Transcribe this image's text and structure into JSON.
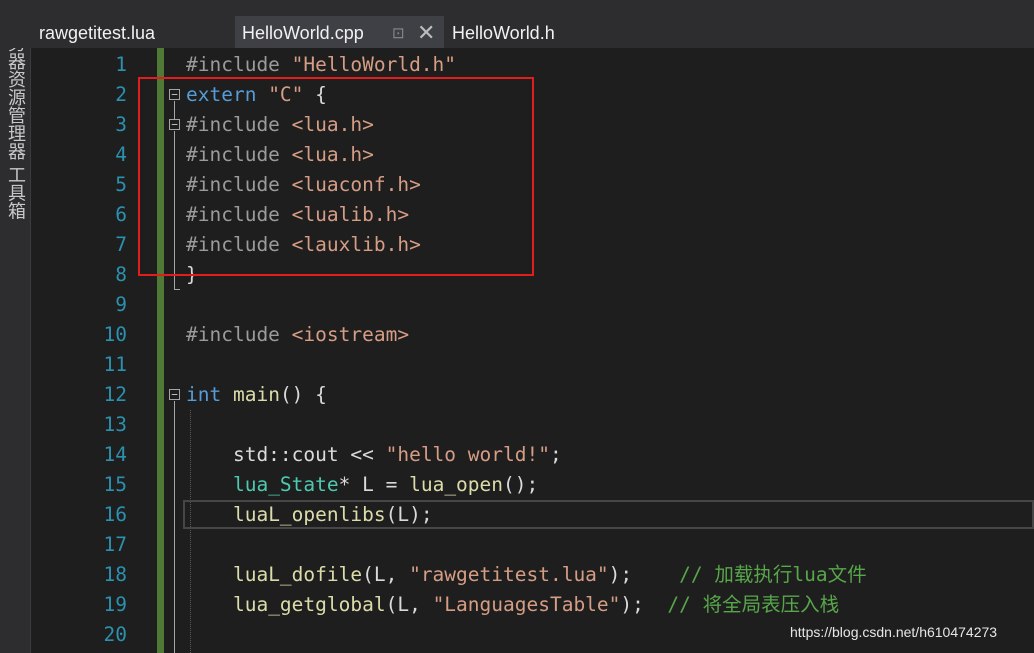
{
  "sidebar": {
    "label": "服务器资源管理器  工具箱"
  },
  "tabs": [
    {
      "label": "rawgetitest.lua",
      "active": false
    },
    {
      "label": "HelloWorld.cpp",
      "active": true
    },
    {
      "label": "HelloWorld.h",
      "active": false
    }
  ],
  "tab_icons": {
    "pin": "pin-icon",
    "close": "close-icon"
  },
  "lines": [
    {
      "n": "1",
      "tokens": [
        [
          "pp",
          "#include "
        ],
        [
          "str",
          "\"HelloWorld.h\""
        ]
      ]
    },
    {
      "n": "2",
      "tokens": [
        [
          "kw",
          "extern "
        ],
        [
          "str",
          "\"C\""
        ],
        [
          "vr",
          " {"
        ]
      ]
    },
    {
      "n": "3",
      "tokens": [
        [
          "pp",
          "#include "
        ],
        [
          "str",
          "<lua.h>"
        ]
      ]
    },
    {
      "n": "4",
      "tokens": [
        [
          "pp",
          "#include "
        ],
        [
          "str",
          "<lua.h>"
        ]
      ]
    },
    {
      "n": "5",
      "tokens": [
        [
          "pp",
          "#include "
        ],
        [
          "str",
          "<luaconf.h>"
        ]
      ]
    },
    {
      "n": "6",
      "tokens": [
        [
          "pp",
          "#include "
        ],
        [
          "str",
          "<lualib.h>"
        ]
      ]
    },
    {
      "n": "7",
      "tokens": [
        [
          "pp",
          "#include "
        ],
        [
          "str",
          "<lauxlib.h>"
        ]
      ]
    },
    {
      "n": "8",
      "tokens": [
        [
          "vr",
          "}"
        ]
      ]
    },
    {
      "n": "9",
      "tokens": []
    },
    {
      "n": "10",
      "tokens": [
        [
          "pp",
          "#include "
        ],
        [
          "str",
          "<iostream>"
        ]
      ]
    },
    {
      "n": "11",
      "tokens": []
    },
    {
      "n": "12",
      "tokens": [
        [
          "kw",
          "int "
        ],
        [
          "fn",
          "main"
        ],
        [
          "vr",
          "() {"
        ]
      ]
    },
    {
      "n": "13",
      "tokens": []
    },
    {
      "n": "14",
      "tokens": [
        [
          "vr",
          "    std::cout << "
        ],
        [
          "str",
          "\"hello world!\""
        ],
        [
          "vr",
          ";"
        ]
      ]
    },
    {
      "n": "15",
      "tokens": [
        [
          "vr",
          "    "
        ],
        [
          "ty",
          "lua_State"
        ],
        [
          "vr",
          "* L = "
        ],
        [
          "fn",
          "lua_open"
        ],
        [
          "vr",
          "();"
        ]
      ]
    },
    {
      "n": "16",
      "tokens": [
        [
          "vr",
          "    "
        ],
        [
          "fn",
          "luaL_openlibs"
        ],
        [
          "vr",
          "(L);"
        ]
      ]
    },
    {
      "n": "17",
      "tokens": []
    },
    {
      "n": "18",
      "tokens": [
        [
          "vr",
          "    "
        ],
        [
          "fn",
          "luaL_dofile"
        ],
        [
          "vr",
          "(L, "
        ],
        [
          "str",
          "\"rawgetitest.lua\""
        ],
        [
          "vr",
          ");    "
        ],
        [
          "cm",
          "// 加载执行lua文件"
        ]
      ]
    },
    {
      "n": "19",
      "tokens": [
        [
          "vr",
          "    "
        ],
        [
          "fn",
          "lua_getglobal"
        ],
        [
          "vr",
          "(L, "
        ],
        [
          "str",
          "\"LanguagesTable\""
        ],
        [
          "vr",
          ");  "
        ],
        [
          "cm",
          "// 将全局表压入栈"
        ]
      ]
    },
    {
      "n": "20",
      "tokens": []
    }
  ],
  "watermark": "https://blog.csdn.net/h610474273",
  "colors": {
    "background": "#1e1e1e",
    "line_number": "#2b91af",
    "keyword": "#569cd6",
    "string": "#d69d85",
    "preprocessor": "#9b9b9b",
    "type": "#4ec9b0",
    "function": "#dcdcaa",
    "comment": "#57a64a",
    "highlight_box": "#e31c1c",
    "change_bar": "#4e7a36"
  }
}
